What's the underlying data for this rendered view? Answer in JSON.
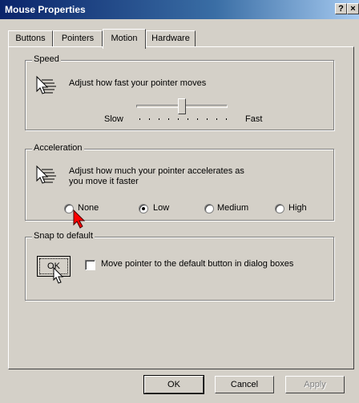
{
  "window": {
    "title": "Mouse Properties",
    "help_label": "?",
    "close_label": "×"
  },
  "tabs": [
    {
      "label": "Buttons"
    },
    {
      "label": "Pointers"
    },
    {
      "label": "Motion",
      "active": true
    },
    {
      "label": "Hardware"
    }
  ],
  "speed": {
    "legend": "Speed",
    "description": "Adjust how fast your pointer moves",
    "slow_label": "Slow",
    "fast_label": "Fast",
    "slider_level": 0.5
  },
  "acceleration": {
    "legend": "Acceleration",
    "description_line1": "Adjust how much your pointer accelerates as",
    "description_line2": "you move it faster",
    "options": [
      {
        "label": "None",
        "checked": false
      },
      {
        "label": "Low",
        "checked": true
      },
      {
        "label": "Medium",
        "checked": false
      },
      {
        "label": "High",
        "checked": false
      }
    ]
  },
  "snap": {
    "legend": "Snap to default",
    "icon_label": "OK",
    "checkbox_label": "Move pointer to the default button in dialog boxes",
    "checked": false
  },
  "buttons": {
    "ok": "OK",
    "cancel": "Cancel",
    "apply": "Apply"
  },
  "colors": {
    "titlebar": "#0a246a",
    "face": "#d4d0c8",
    "cursor_red": "#ff0000"
  }
}
